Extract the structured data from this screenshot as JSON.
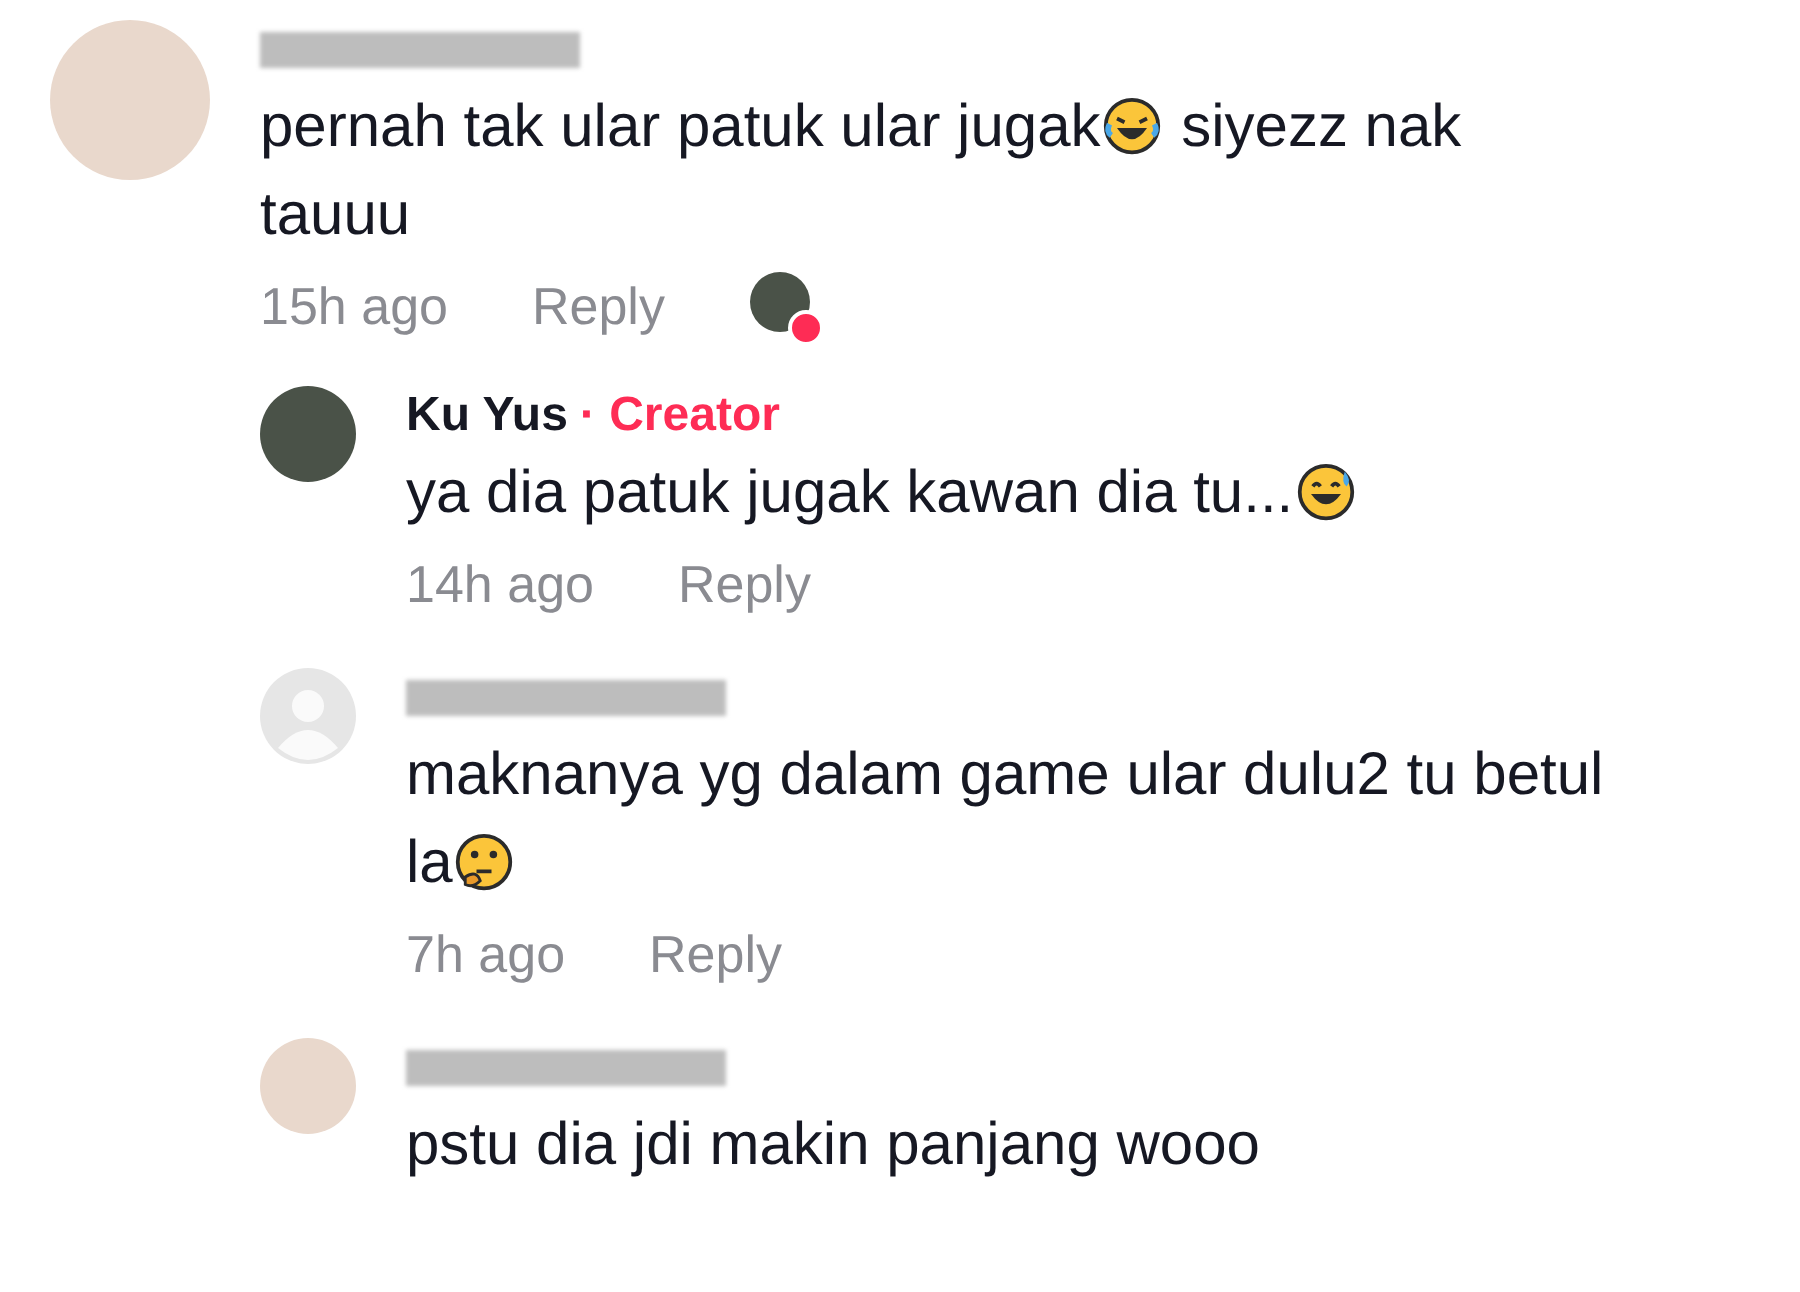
{
  "comments": [
    {
      "author": {
        "kind": "hidden"
      },
      "avatar": {
        "kind": "photo"
      },
      "body": [
        {
          "kind": "text",
          "text": "pernah tak ular patuk ular jugak"
        },
        {
          "kind": "laugh"
        },
        {
          "kind": "text",
          "text": "siyezz nak"
        },
        {
          "kind": "text",
          "text": "tauuu"
        }
      ],
      "time": "15h ago",
      "reply": "Reply",
      "creator_liked": true,
      "replies": [
        {
          "author": {
            "kind": "shown",
            "name": "Ku Yus",
            "badge": "· Creator"
          },
          "avatar": {
            "kind": "landscape"
          },
          "body": [
            {
              "kind": "text",
              "text": "ya dia patuk jugak kawan dia tu..."
            },
            {
              "kind": "sweat"
            }
          ],
          "time": "14h ago",
          "reply": "Reply"
        },
        {
          "author": {
            "kind": "hidden"
          },
          "avatar": {
            "kind": "default"
          },
          "body": [
            {
              "kind": "text",
              "text": "maknanya yg dalam game ular dulu2 tu betul"
            },
            {
              "kind": "text",
              "text": "la"
            },
            {
              "kind": "think"
            }
          ],
          "time": "7h ago",
          "reply": "Reply"
        },
        {
          "author": {
            "kind": "hidden"
          },
          "avatar": {
            "kind": "photo"
          },
          "body": [
            {
              "kind": "text",
              "text": "pstu dia jdi makin panjang wooo"
            }
          ]
        }
      ]
    }
  ]
}
